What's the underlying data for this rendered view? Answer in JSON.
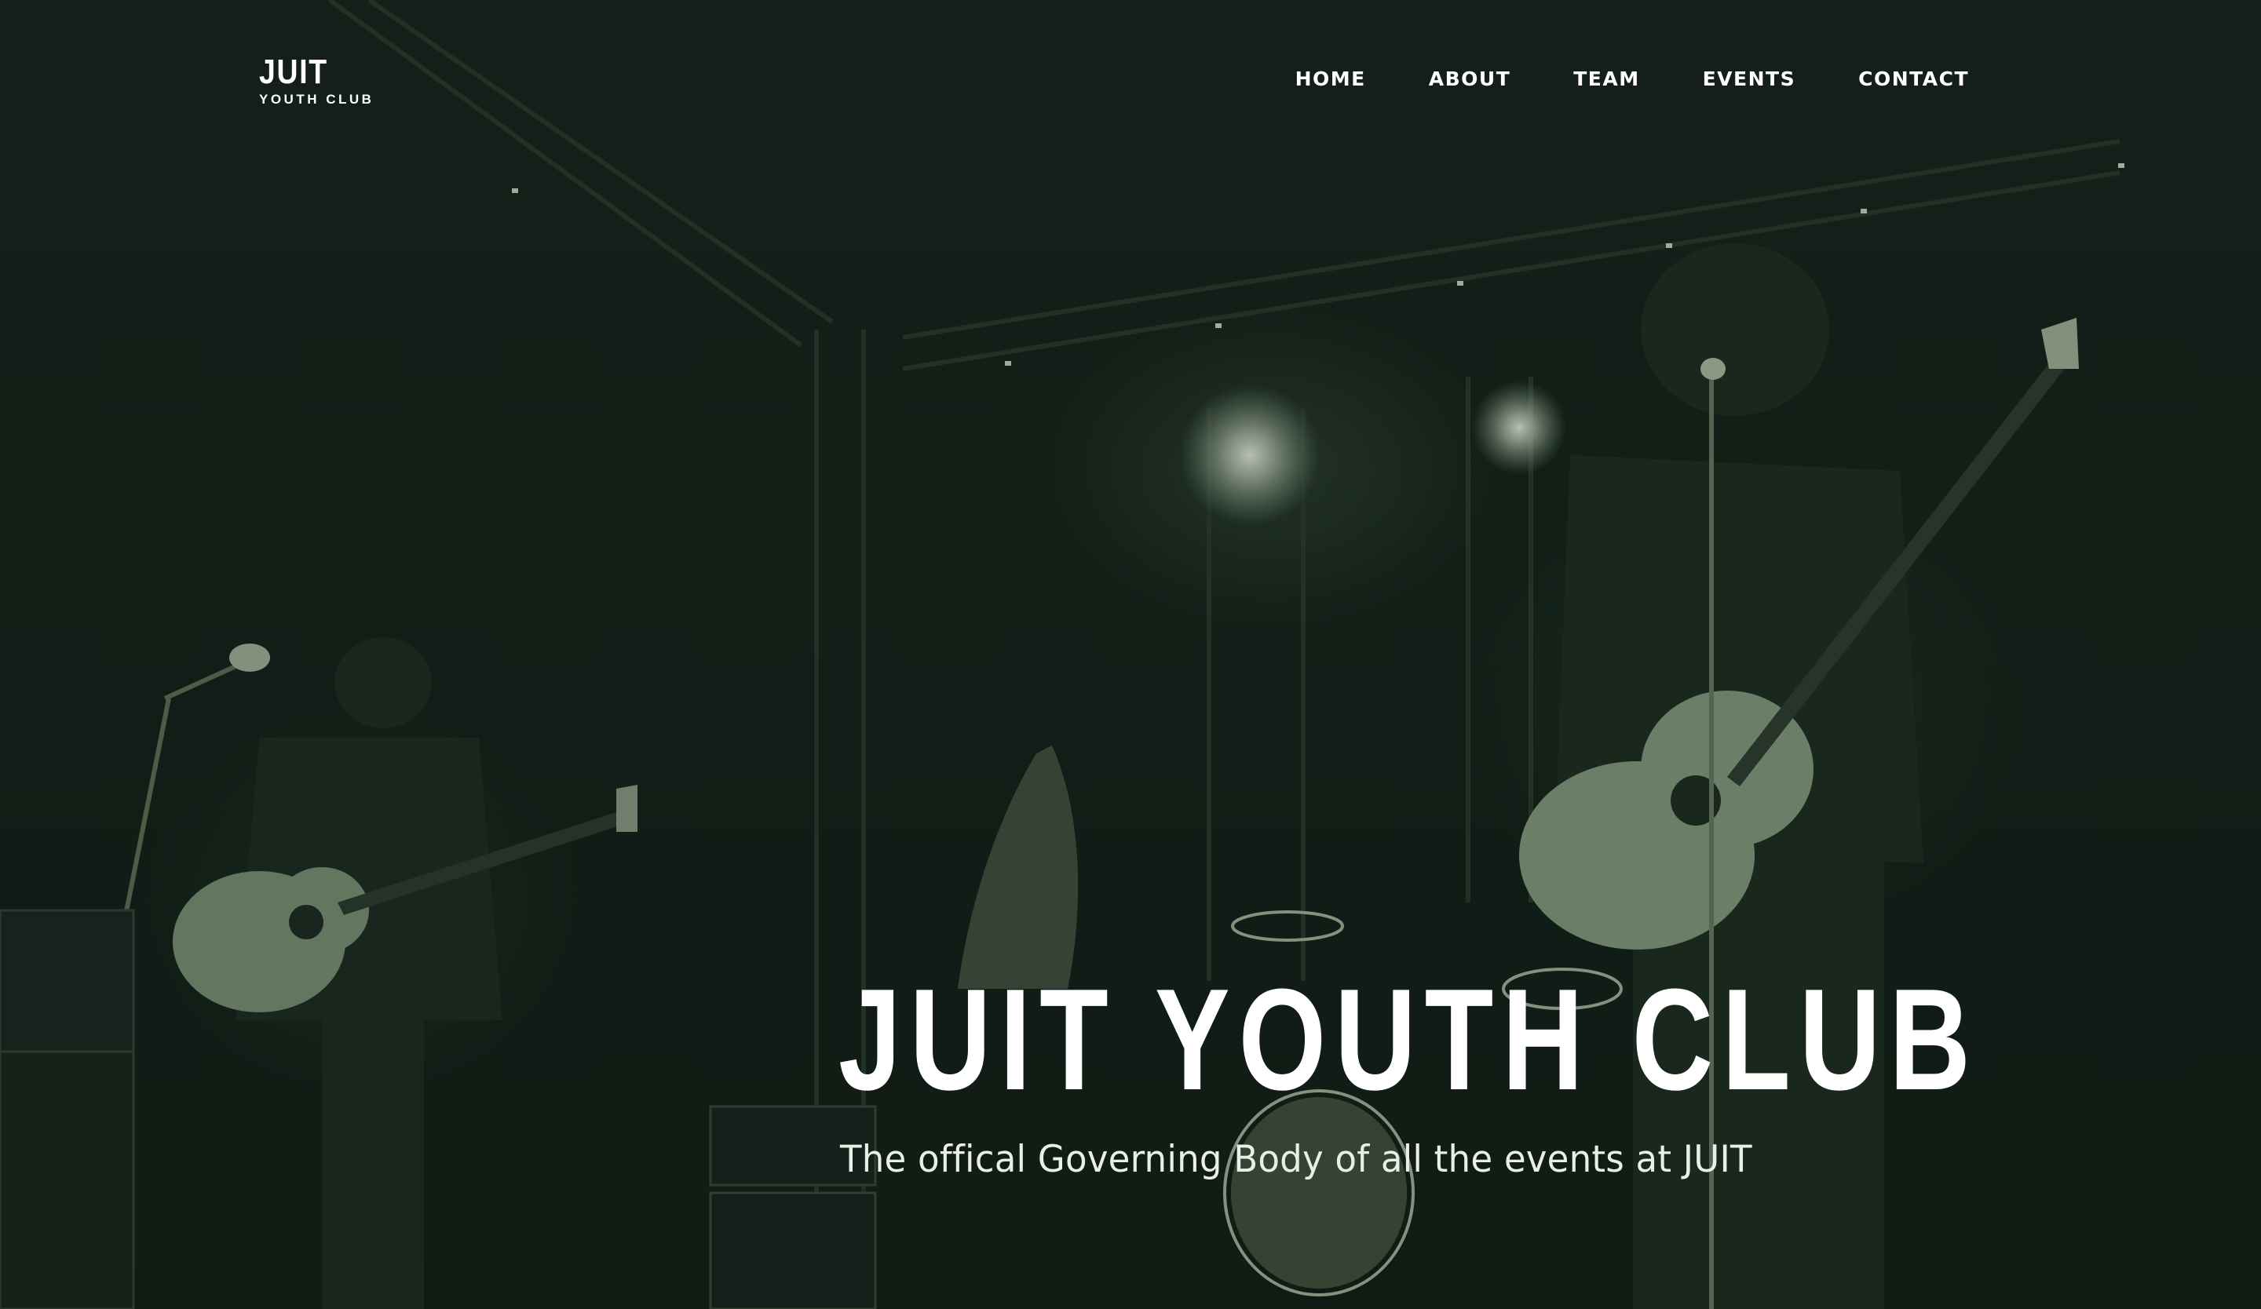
{
  "brand": {
    "logo_main": "JUIT",
    "logo_sub": "YOUTH CLUB"
  },
  "nav": {
    "items": [
      {
        "label": "HOME"
      },
      {
        "label": "ABOUT"
      },
      {
        "label": "TEAM"
      },
      {
        "label": "EVENTS"
      },
      {
        "label": "CONTACT"
      }
    ]
  },
  "hero": {
    "title": "JUIT YOUTH CLUB",
    "subtitle": "The offical Governing Body of all the events at JUIT",
    "image_subject": "concert-stage-photo"
  },
  "colors": {
    "overlay": "#142016",
    "text": "#ffffff"
  }
}
